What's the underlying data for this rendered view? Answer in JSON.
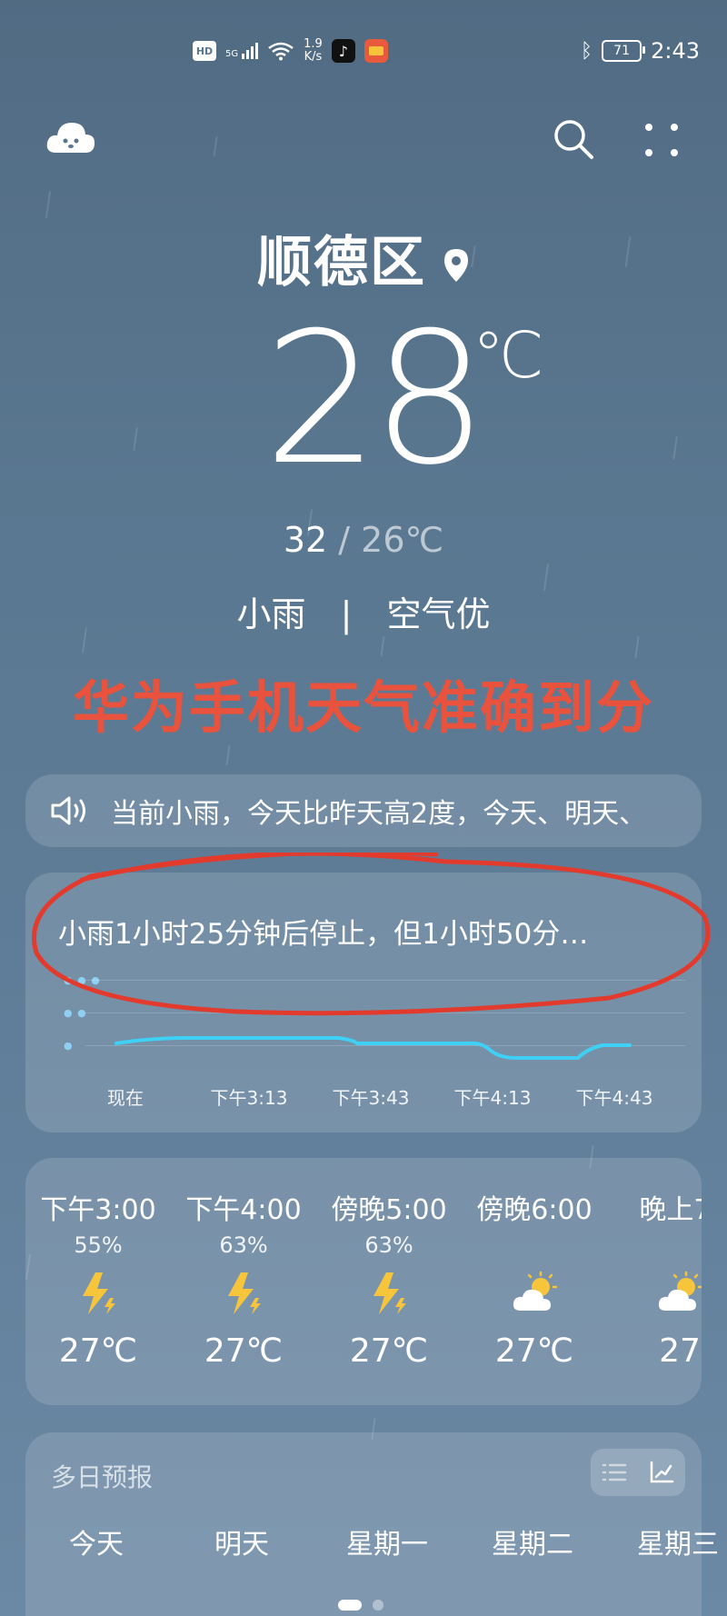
{
  "status_bar": {
    "hd": "HD",
    "network": "5G",
    "speed_value": "1.9",
    "speed_unit": "K/s",
    "battery": "71",
    "time": "2:43"
  },
  "location": {
    "city": "顺德区"
  },
  "current": {
    "temp": "28",
    "unit": "℃",
    "high": "32",
    "low": "26℃",
    "condition": "小雨",
    "separator": "|",
    "air": "空气优"
  },
  "banner": "华为手机天气准确到分",
  "ticker": {
    "text": "当前小雨，今天比昨天高2度，今天、明天、"
  },
  "minute_forecast": {
    "summary": "小雨1小时25分钟后停止，但1小时50分…",
    "time_labels": [
      "现在",
      "下午3:13",
      "下午3:43",
      "下午4:13",
      "下午4:43"
    ]
  },
  "hourly": [
    {
      "time": "下午3:00",
      "precip": "55%",
      "icon": "thunder-icon",
      "temp": "27℃"
    },
    {
      "time": "下午4:00",
      "precip": "63%",
      "icon": "thunder-icon",
      "temp": "27℃"
    },
    {
      "time": "傍晚5:00",
      "precip": "63%",
      "icon": "thunder-icon",
      "temp": "27℃"
    },
    {
      "time": "傍晚6:00",
      "precip": "",
      "icon": "partly-cloudy-icon",
      "temp": "27℃"
    },
    {
      "time": "晚上7:",
      "precip": "",
      "icon": "partly-cloudy-icon",
      "temp": "27"
    }
  ],
  "daily": {
    "title": "多日预报",
    "days": [
      "今天",
      "明天",
      "星期一",
      "星期二",
      "星期三"
    ]
  },
  "colors": {
    "banner": "#e9523c",
    "rain_line": "#3fd0f5",
    "annotation": "#e23b2e"
  }
}
